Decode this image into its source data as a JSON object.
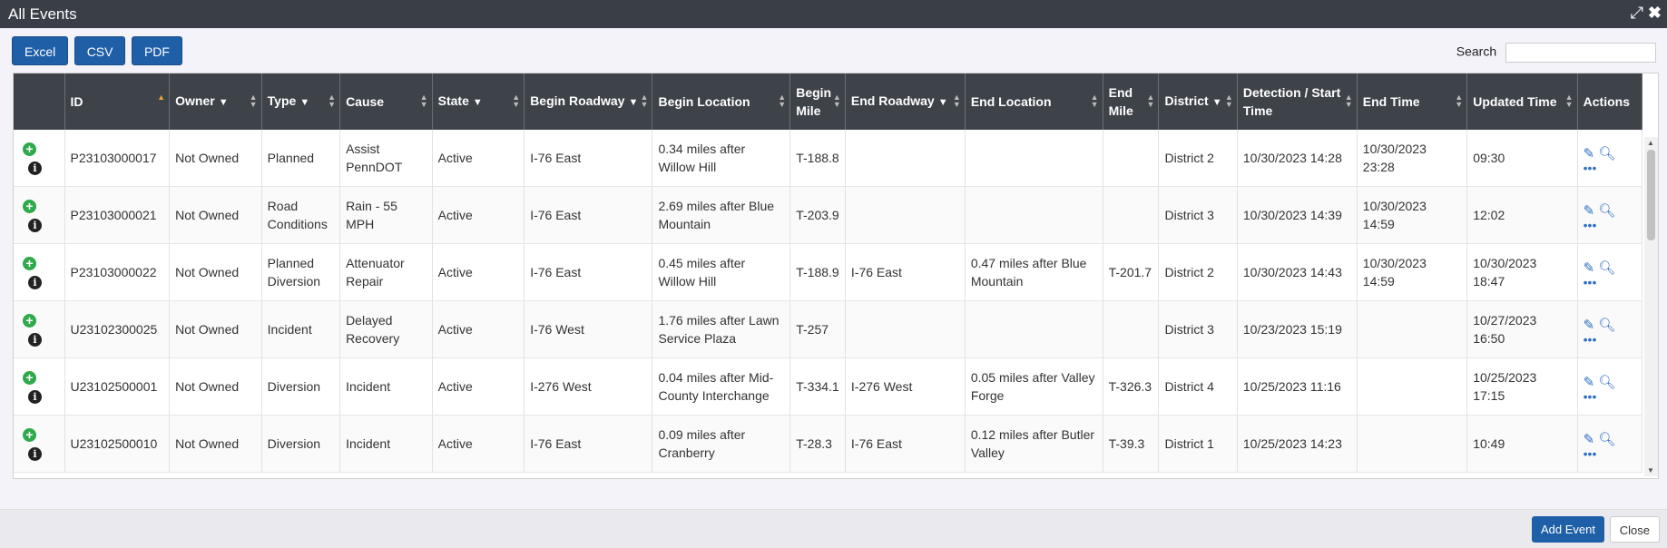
{
  "window": {
    "title": "All Events"
  },
  "toolbar": {
    "excel": "Excel",
    "csv": "CSV",
    "pdf": "PDF",
    "search_label": "Search",
    "search_value": ""
  },
  "table": {
    "headers": {
      "id": "ID",
      "owner": "Owner",
      "type": "Type",
      "cause": "Cause",
      "state": "State",
      "begin_roadway": "Begin Roadway",
      "begin_location": "Begin Location",
      "begin_mile": "Begin Mile",
      "end_roadway": "End Roadway",
      "end_location": "End Location",
      "end_mile": "End Mile",
      "district": "District",
      "detection": "Detection / Start Time",
      "end_time": "End Time",
      "updated": "Updated Time",
      "actions": "Actions"
    },
    "rows": [
      {
        "id": "P23103000017",
        "owner": "Not Owned",
        "type": "Planned",
        "cause": "Assist PennDOT",
        "state": "Active",
        "begin_roadway": "I-76 East",
        "begin_location": "0.34 miles after Willow Hill",
        "begin_mile": "T-188.8",
        "end_roadway": "",
        "end_location": "",
        "end_mile": "",
        "district": "District 2",
        "detection": "10/30/2023 14:28",
        "end_time": "10/30/2023 23:28",
        "updated": "09:30"
      },
      {
        "id": "P23103000021",
        "owner": "Not Owned",
        "type": "Road Conditions",
        "cause": "Rain - 55 MPH",
        "state": "Active",
        "begin_roadway": "I-76 East",
        "begin_location": "2.69 miles after Blue Mountain",
        "begin_mile": "T-203.9",
        "end_roadway": "",
        "end_location": "",
        "end_mile": "",
        "district": "District 3",
        "detection": "10/30/2023 14:39",
        "end_time": "10/30/2023 14:59",
        "updated": "12:02"
      },
      {
        "id": "P23103000022",
        "owner": "Not Owned",
        "type": "Planned Diversion",
        "cause": "Attenuator Repair",
        "state": "Active",
        "begin_roadway": "I-76 East",
        "begin_location": "0.45 miles after Willow Hill",
        "begin_mile": "T-188.9",
        "end_roadway": "I-76 East",
        "end_location": "0.47 miles after Blue Mountain",
        "end_mile": "T-201.7",
        "district": "District 2",
        "detection": "10/30/2023 14:43",
        "end_time": "10/30/2023 14:59",
        "updated": "10/30/2023 18:47"
      },
      {
        "id": "U23102300025",
        "owner": "Not Owned",
        "type": "Incident",
        "cause": "Delayed Recovery",
        "state": "Active",
        "begin_roadway": "I-76 West",
        "begin_location": "1.76 miles after Lawn Service Plaza",
        "begin_mile": "T-257",
        "end_roadway": "",
        "end_location": "",
        "end_mile": "",
        "district": "District 3",
        "detection": "10/23/2023 15:19",
        "end_time": "",
        "updated": "10/27/2023 16:50"
      },
      {
        "id": "U23102500001",
        "owner": "Not Owned",
        "type": "Diversion",
        "cause": "Incident",
        "state": "Active",
        "begin_roadway": "I-276 West",
        "begin_location": "0.04 miles after Mid-County Interchange",
        "begin_mile": "T-334.1",
        "end_roadway": "I-276 West",
        "end_location": "0.05 miles after Valley Forge",
        "end_mile": "T-326.3",
        "district": "District 4",
        "detection": "10/25/2023 11:16",
        "end_time": "",
        "updated": "10/25/2023 17:15"
      },
      {
        "id": "U23102500010",
        "owner": "Not Owned",
        "type": "Diversion",
        "cause": "Incident",
        "state": "Active",
        "begin_roadway": "I-76 East",
        "begin_location": "0.09 miles after Cranberry",
        "begin_mile": "T-28.3",
        "end_roadway": "I-76 East",
        "end_location": "0.12 miles after Butler Valley",
        "end_mile": "T-39.3",
        "district": "District 1",
        "detection": "10/25/2023 14:23",
        "end_time": "",
        "updated": "10:49"
      }
    ]
  },
  "footer": {
    "add_event": "Add Event",
    "close": "Close"
  },
  "colors": {
    "header_bg": "#3e4249",
    "primary": "#1f5fa8",
    "titlebar": "#3a3f47",
    "plus": "#2eaa4b",
    "sort_active": "#e8a23a"
  }
}
